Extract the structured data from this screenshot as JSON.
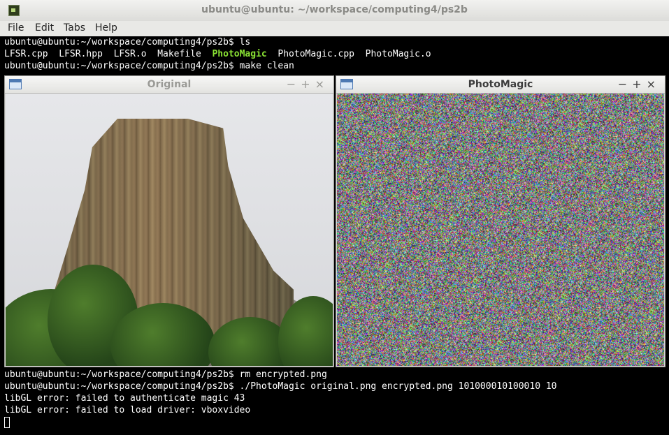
{
  "window": {
    "title": "ubuntu@ubuntu: ~/workspace/computing4/ps2b"
  },
  "menu": [
    "File",
    "Edit",
    "Tabs",
    "Help"
  ],
  "terminal": {
    "prompt": "ubuntu@ubuntu:~/workspace/computing4/ps2b$",
    "cmd1": " ls",
    "ls_files": [
      "LFSR.cpp",
      "LFSR.hpp",
      "LFSR.o",
      "Makefile",
      "PhotoMagic",
      "PhotoMagic.cpp",
      "PhotoMagic.o"
    ],
    "cmd2": " make clean",
    "cmd3": " rm encrypted.png",
    "cmd4": " ./PhotoMagic original.png encrypted.png 101000010100010 10",
    "error1": "libGL error: failed to authenticate magic 43",
    "error2": "libGL error: failed to load driver: vboxvideo"
  },
  "windows": {
    "original": {
      "title": "Original",
      "title_color": "#9a9a96"
    },
    "photomagic": {
      "title": "PhotoMagic",
      "title_color": "#3c3c3c"
    }
  },
  "window_controls": {
    "minimize": "−",
    "maximize": "+",
    "close": "×"
  },
  "colors": {
    "executable": "#8ae234",
    "terminal_bg": "#000000",
    "terminal_fg": "#ffffff"
  }
}
